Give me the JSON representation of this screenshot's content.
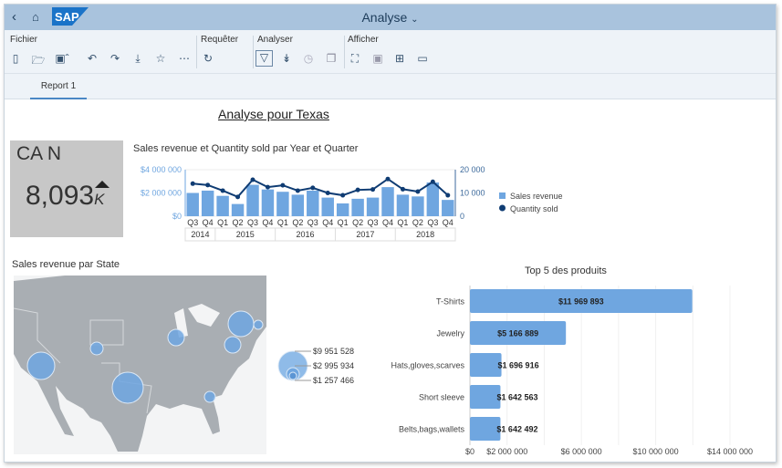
{
  "shell": {
    "back_icon": "chevron-left-icon",
    "home_icon": "home-icon",
    "logo": "SAP",
    "title": "Analyse"
  },
  "toolbar": {
    "groups": [
      {
        "label": "Fichier"
      },
      {
        "label": "Requêter"
      },
      {
        "label": "Analyser"
      },
      {
        "label": "Afficher"
      }
    ]
  },
  "tabs": [
    {
      "label": "Report 1",
      "active": true
    }
  ],
  "report": {
    "title": "Analyse pour Texas"
  },
  "kpi": {
    "label": "CA N",
    "value": "8,093",
    "unit": "K",
    "trend": "up"
  },
  "colors": {
    "bar": "#6fa6e0",
    "line": "#0f3c73",
    "shell": "#a9c3dd",
    "map_land": "#a9aeb3"
  },
  "chart_data": [
    {
      "type": "bar+line",
      "title": "Sales revenue et Quantity sold par Year et Quarter",
      "categories": [
        "Q3",
        "Q4",
        "Q1",
        "Q2",
        "Q3",
        "Q4",
        "Q1",
        "Q2",
        "Q3",
        "Q4",
        "Q1",
        "Q2",
        "Q3",
        "Q4",
        "Q1",
        "Q2",
        "Q3",
        "Q4"
      ],
      "years": [
        {
          "label": "2014",
          "span": 2
        },
        {
          "label": "2015",
          "span": 4
        },
        {
          "label": "2016",
          "span": 4
        },
        {
          "label": "2017",
          "span": 4
        },
        {
          "label": "2018",
          "span": 4
        }
      ],
      "series": [
        {
          "name": "Sales revenue",
          "type": "bar",
          "axis": "left",
          "values": [
            2000000,
            2200000,
            1750000,
            1050000,
            2700000,
            2300000,
            2100000,
            1850000,
            2200000,
            1600000,
            1100000,
            1500000,
            1600000,
            2500000,
            1850000,
            1700000,
            2900000,
            1400000
          ]
        },
        {
          "name": "Quantity sold",
          "type": "line",
          "axis": "right",
          "values": [
            14000,
            13400,
            11000,
            8300,
            15700,
            12500,
            13300,
            11000,
            12200,
            10000,
            9000,
            11300,
            11500,
            16000,
            11600,
            10600,
            14800,
            9000
          ]
        }
      ],
      "y_left": {
        "ticks": [
          "$0",
          "$2 000 000",
          "$4 000 000"
        ],
        "range": [
          0,
          4000000
        ]
      },
      "y_right": {
        "ticks": [
          "0",
          "10 000",
          "20 000"
        ],
        "range": [
          0,
          20000
        ]
      },
      "legend": "right"
    },
    {
      "type": "bubble-map",
      "title": "Sales revenue par State",
      "legend_values": [
        "$9 951 528",
        "$2 995 934",
        "$1 257 466"
      ]
    },
    {
      "type": "bar",
      "orientation": "horizontal",
      "title": "Top 5 des produits",
      "categories": [
        "T-Shirts",
        "Jewelry",
        "Hats,gloves,scarves",
        "Short sleeve",
        "Belts,bags,wallets"
      ],
      "values": [
        11969893,
        5166889,
        1696916,
        1642563,
        1642492
      ],
      "data_labels": [
        "$11 969 893",
        "$5 166 889",
        "$1 696 916",
        "$1 642 563",
        "$1 642 492"
      ],
      "x_ticks": [
        "$0",
        "$2 000 000",
        "$6 000 000",
        "$10 000 000",
        "$14 000 000"
      ],
      "xlim": [
        0,
        14000000
      ]
    }
  ]
}
